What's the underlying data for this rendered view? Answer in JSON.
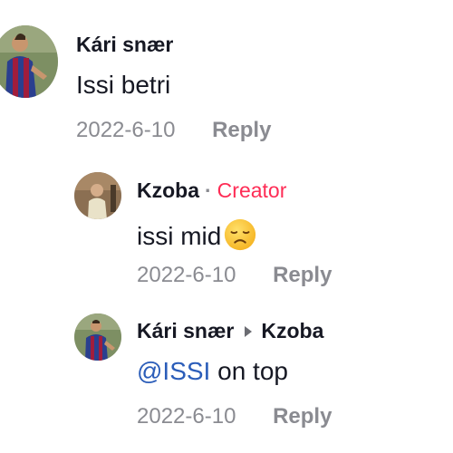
{
  "comments": [
    {
      "username": "Kári snær",
      "text": "Issi betri",
      "date": "2022-6-10",
      "reply_label": "Reply"
    },
    {
      "username": "Kzoba",
      "separator": "·",
      "badge": "Creator",
      "text": "issi mid",
      "emoji": "disappointed-face-icon",
      "date": "2022-6-10",
      "reply_label": "Reply"
    },
    {
      "username": "Kári snær",
      "reply_to": "Kzoba",
      "mention": "@ISSI",
      "text": " on top",
      "date": "2022-6-10",
      "reply_label": "Reply"
    }
  ],
  "colors": {
    "creator_badge": "#fe2c55",
    "mention": "#2b5db9",
    "muted": "#8a8b91",
    "text": "#161823"
  }
}
